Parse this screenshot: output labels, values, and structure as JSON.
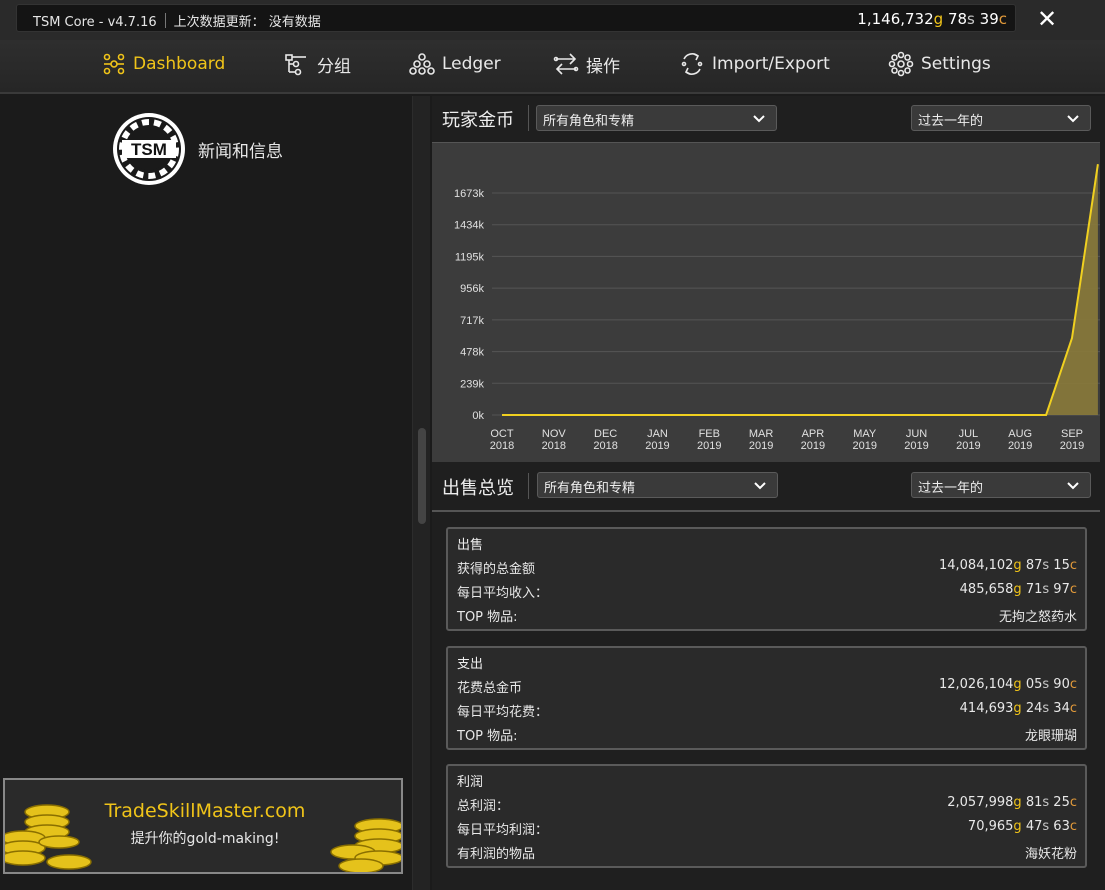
{
  "titlebar": {
    "app": "TSM Core - v4.7.16",
    "last_update_label": "上次数据更新：",
    "last_update_value": "没有数据",
    "gold": "1,146,732",
    "silver": "78",
    "copper": "39",
    "gold_suffix": "g",
    "silver_suffix": "s",
    "copper_suffix": "c",
    "close_label": "✕"
  },
  "nav": {
    "dashboard": "Dashboard",
    "groups": "分组",
    "ledger": "Ledger",
    "operations": "操作",
    "import_export": "Import/Export",
    "settings": "Settings"
  },
  "left": {
    "news_label": "新闻和信息",
    "logo_text": "TSM",
    "banner_title": "TradeSkillMaster.com",
    "banner_sub": "提升你的gold-making!"
  },
  "gold_section": {
    "title": "玩家金币",
    "filter": "所有角色和专精",
    "period": "过去一年的"
  },
  "sales_section": {
    "title": "出售总览",
    "filter": "所有角色和专精",
    "period": "过去一年的"
  },
  "sales": {
    "title": "出售",
    "rows": [
      {
        "label": "获得的总金额",
        "g": "14,084,102",
        "s": "87",
        "c": "15"
      },
      {
        "label": "每日平均收入：",
        "g": "485,658",
        "s": "71",
        "c": "97"
      }
    ],
    "top_label": "TOP 物品:",
    "top_value": "无拘之怒药水"
  },
  "expenses": {
    "title": "支出",
    "rows": [
      {
        "label": "花费总金币",
        "g": "12,026,104",
        "s": "05",
        "c": "90"
      },
      {
        "label": "每日平均花费：",
        "g": "414,693",
        "s": "24",
        "c": "34"
      }
    ],
    "top_label": "TOP 物品:",
    "top_value": "龙眼珊瑚"
  },
  "profit": {
    "title": "利润",
    "rows": [
      {
        "label": "总利润：",
        "g": "2,057,998",
        "s": "81",
        "c": "25"
      },
      {
        "label": "每日平均利润：",
        "g": "70,965",
        "s": "47",
        "c": "63"
      }
    ],
    "top_label": "有利润的物品",
    "top_value": "海妖花粉"
  },
  "chart_data": {
    "type": "area",
    "title": "",
    "xlabel": "",
    "ylabel": "",
    "y_ticks": [
      "0k",
      "239k",
      "478k",
      "717k",
      "956k",
      "1195k",
      "1434k",
      "1673k"
    ],
    "ylim": [
      0,
      1673
    ],
    "categories": [
      "OCT 2018",
      "NOV 2018",
      "DEC 2018",
      "JAN 2019",
      "FEB 2019",
      "MAR 2019",
      "APR 2019",
      "MAY 2019",
      "JUN 2019",
      "JUL 2019",
      "AUG 2019",
      "SEP 2019"
    ],
    "x": [
      0,
      1,
      2,
      3,
      4,
      5,
      6,
      7,
      8,
      9,
      10,
      10.5,
      11,
      11.5
    ],
    "values": [
      0,
      0,
      0,
      0,
      0,
      0,
      0,
      0,
      0,
      0,
      0,
      0,
      580,
      1890
    ],
    "line_color": "#f0d020",
    "fill_color": "#8a7a3a",
    "grid": true
  },
  "colors": {
    "accent": "#f0c419",
    "gold": "#f0c419",
    "silver": "#c8c8c8",
    "copper": "#e29a3a"
  }
}
